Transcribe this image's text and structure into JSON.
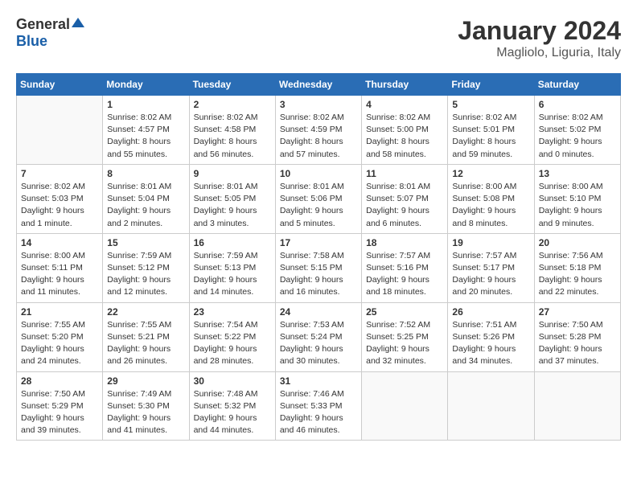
{
  "header": {
    "logo_general": "General",
    "logo_blue": "Blue",
    "month": "January 2024",
    "location": "Magliolo, Liguria, Italy"
  },
  "weekdays": [
    "Sunday",
    "Monday",
    "Tuesday",
    "Wednesday",
    "Thursday",
    "Friday",
    "Saturday"
  ],
  "weeks": [
    [
      {
        "day": "",
        "info": ""
      },
      {
        "day": "1",
        "info": "Sunrise: 8:02 AM\nSunset: 4:57 PM\nDaylight: 8 hours\nand 55 minutes."
      },
      {
        "day": "2",
        "info": "Sunrise: 8:02 AM\nSunset: 4:58 PM\nDaylight: 8 hours\nand 56 minutes."
      },
      {
        "day": "3",
        "info": "Sunrise: 8:02 AM\nSunset: 4:59 PM\nDaylight: 8 hours\nand 57 minutes."
      },
      {
        "day": "4",
        "info": "Sunrise: 8:02 AM\nSunset: 5:00 PM\nDaylight: 8 hours\nand 58 minutes."
      },
      {
        "day": "5",
        "info": "Sunrise: 8:02 AM\nSunset: 5:01 PM\nDaylight: 8 hours\nand 59 minutes."
      },
      {
        "day": "6",
        "info": "Sunrise: 8:02 AM\nSunset: 5:02 PM\nDaylight: 9 hours\nand 0 minutes."
      }
    ],
    [
      {
        "day": "7",
        "info": "Sunrise: 8:02 AM\nSunset: 5:03 PM\nDaylight: 9 hours\nand 1 minute."
      },
      {
        "day": "8",
        "info": "Sunrise: 8:01 AM\nSunset: 5:04 PM\nDaylight: 9 hours\nand 2 minutes."
      },
      {
        "day": "9",
        "info": "Sunrise: 8:01 AM\nSunset: 5:05 PM\nDaylight: 9 hours\nand 3 minutes."
      },
      {
        "day": "10",
        "info": "Sunrise: 8:01 AM\nSunset: 5:06 PM\nDaylight: 9 hours\nand 5 minutes."
      },
      {
        "day": "11",
        "info": "Sunrise: 8:01 AM\nSunset: 5:07 PM\nDaylight: 9 hours\nand 6 minutes."
      },
      {
        "day": "12",
        "info": "Sunrise: 8:00 AM\nSunset: 5:08 PM\nDaylight: 9 hours\nand 8 minutes."
      },
      {
        "day": "13",
        "info": "Sunrise: 8:00 AM\nSunset: 5:10 PM\nDaylight: 9 hours\nand 9 minutes."
      }
    ],
    [
      {
        "day": "14",
        "info": "Sunrise: 8:00 AM\nSunset: 5:11 PM\nDaylight: 9 hours\nand 11 minutes."
      },
      {
        "day": "15",
        "info": "Sunrise: 7:59 AM\nSunset: 5:12 PM\nDaylight: 9 hours\nand 12 minutes."
      },
      {
        "day": "16",
        "info": "Sunrise: 7:59 AM\nSunset: 5:13 PM\nDaylight: 9 hours\nand 14 minutes."
      },
      {
        "day": "17",
        "info": "Sunrise: 7:58 AM\nSunset: 5:15 PM\nDaylight: 9 hours\nand 16 minutes."
      },
      {
        "day": "18",
        "info": "Sunrise: 7:57 AM\nSunset: 5:16 PM\nDaylight: 9 hours\nand 18 minutes."
      },
      {
        "day": "19",
        "info": "Sunrise: 7:57 AM\nSunset: 5:17 PM\nDaylight: 9 hours\nand 20 minutes."
      },
      {
        "day": "20",
        "info": "Sunrise: 7:56 AM\nSunset: 5:18 PM\nDaylight: 9 hours\nand 22 minutes."
      }
    ],
    [
      {
        "day": "21",
        "info": "Sunrise: 7:55 AM\nSunset: 5:20 PM\nDaylight: 9 hours\nand 24 minutes."
      },
      {
        "day": "22",
        "info": "Sunrise: 7:55 AM\nSunset: 5:21 PM\nDaylight: 9 hours\nand 26 minutes."
      },
      {
        "day": "23",
        "info": "Sunrise: 7:54 AM\nSunset: 5:22 PM\nDaylight: 9 hours\nand 28 minutes."
      },
      {
        "day": "24",
        "info": "Sunrise: 7:53 AM\nSunset: 5:24 PM\nDaylight: 9 hours\nand 30 minutes."
      },
      {
        "day": "25",
        "info": "Sunrise: 7:52 AM\nSunset: 5:25 PM\nDaylight: 9 hours\nand 32 minutes."
      },
      {
        "day": "26",
        "info": "Sunrise: 7:51 AM\nSunset: 5:26 PM\nDaylight: 9 hours\nand 34 minutes."
      },
      {
        "day": "27",
        "info": "Sunrise: 7:50 AM\nSunset: 5:28 PM\nDaylight: 9 hours\nand 37 minutes."
      }
    ],
    [
      {
        "day": "28",
        "info": "Sunrise: 7:50 AM\nSunset: 5:29 PM\nDaylight: 9 hours\nand 39 minutes."
      },
      {
        "day": "29",
        "info": "Sunrise: 7:49 AM\nSunset: 5:30 PM\nDaylight: 9 hours\nand 41 minutes."
      },
      {
        "day": "30",
        "info": "Sunrise: 7:48 AM\nSunset: 5:32 PM\nDaylight: 9 hours\nand 44 minutes."
      },
      {
        "day": "31",
        "info": "Sunrise: 7:46 AM\nSunset: 5:33 PM\nDaylight: 9 hours\nand 46 minutes."
      },
      {
        "day": "",
        "info": ""
      },
      {
        "day": "",
        "info": ""
      },
      {
        "day": "",
        "info": ""
      }
    ]
  ]
}
